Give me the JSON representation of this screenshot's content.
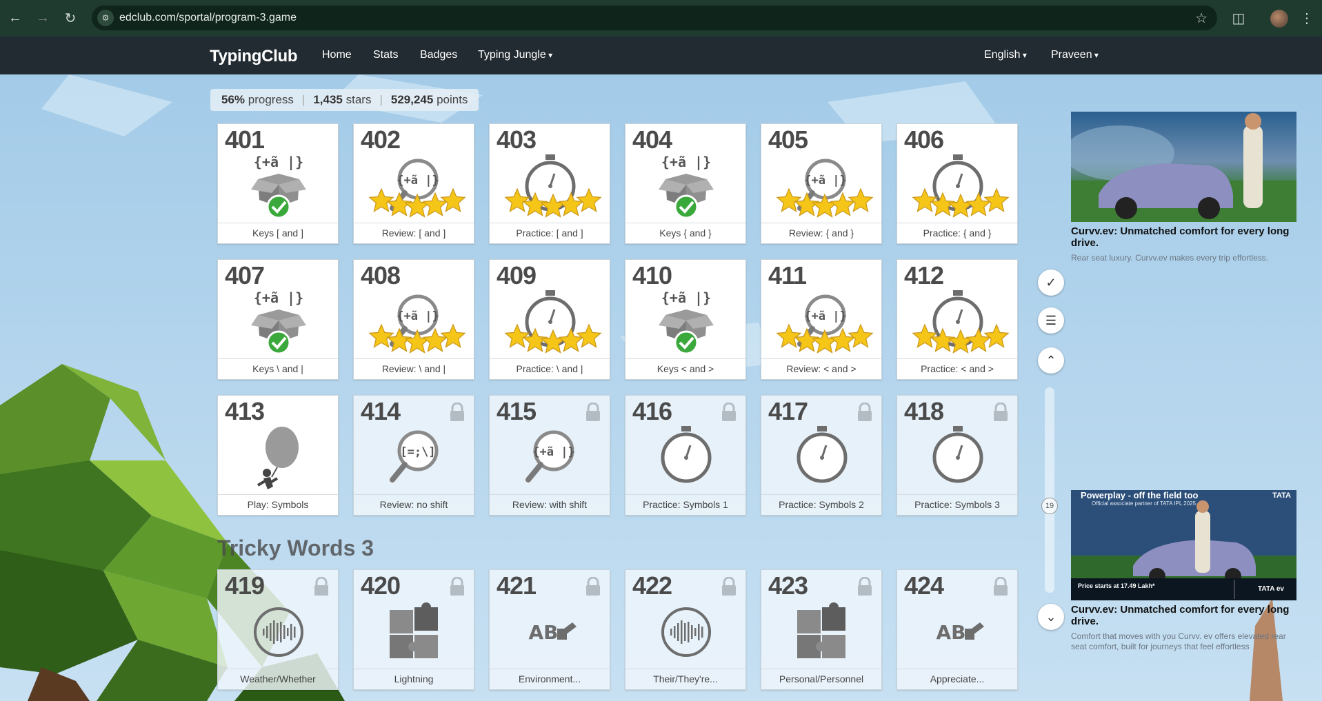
{
  "browser": {
    "url": "edclub.com/sportal/program-3.game"
  },
  "appnav": {
    "brand": "TypingClub",
    "links": [
      "Home",
      "Stats",
      "Badges",
      "Typing Jungle"
    ],
    "language": "English",
    "user": "Praveen"
  },
  "progress": {
    "percent": "56%",
    "percent_label": "progress",
    "stars": "1,435",
    "stars_label": "stars",
    "points": "529,245",
    "points_label": "points"
  },
  "lessons": [
    {
      "num": "401",
      "label": "Keys [ and ]",
      "type": "keys",
      "symbols": "{+ã |}",
      "status": "done",
      "locked": false
    },
    {
      "num": "402",
      "label": "Review: [ and ]",
      "type": "review",
      "symbols": "{+ã |}",
      "status": "stars",
      "locked": false
    },
    {
      "num": "403",
      "label": "Practice: [ and ]",
      "type": "practice",
      "symbols": "",
      "status": "stars",
      "locked": false
    },
    {
      "num": "404",
      "label": "Keys { and }",
      "type": "keys",
      "symbols": "{+ã |}",
      "status": "done",
      "locked": false
    },
    {
      "num": "405",
      "label": "Review: { and }",
      "type": "review",
      "symbols": "{+ã |}",
      "status": "stars",
      "locked": false
    },
    {
      "num": "406",
      "label": "Practice: { and }",
      "type": "practice",
      "symbols": "",
      "status": "stars",
      "locked": false
    },
    {
      "num": "407",
      "label": "Keys \\ and |",
      "type": "keys",
      "symbols": "{+ã |}",
      "status": "done",
      "locked": false
    },
    {
      "num": "408",
      "label": "Review: \\ and |",
      "type": "review",
      "symbols": "{+ã |}",
      "status": "stars",
      "locked": false
    },
    {
      "num": "409",
      "label": "Practice: \\ and |",
      "type": "practice",
      "symbols": "",
      "status": "stars",
      "locked": false
    },
    {
      "num": "410",
      "label": "Keys < and >",
      "type": "keys",
      "symbols": "{+ã |}",
      "status": "done",
      "locked": false
    },
    {
      "num": "411",
      "label": "Review: < and >",
      "type": "review",
      "symbols": "{+ã |}",
      "status": "stars",
      "locked": false
    },
    {
      "num": "412",
      "label": "Practice: < and >",
      "type": "practice",
      "symbols": "",
      "status": "stars",
      "locked": false
    },
    {
      "num": "413",
      "label": "Play: Symbols",
      "type": "play",
      "symbols": "",
      "status": "none",
      "locked": false
    },
    {
      "num": "414",
      "label": "Review: no shift",
      "type": "review",
      "symbols": "[=;\\]",
      "status": "none",
      "locked": true
    },
    {
      "num": "415",
      "label": "Review: with shift",
      "type": "review",
      "symbols": "{+ã |}",
      "status": "none",
      "locked": true
    },
    {
      "num": "416",
      "label": "Practice: Symbols 1",
      "type": "practice",
      "symbols": "",
      "status": "none",
      "locked": true
    },
    {
      "num": "417",
      "label": "Practice: Symbols 2",
      "type": "practice",
      "symbols": "",
      "status": "none",
      "locked": true
    },
    {
      "num": "418",
      "label": "Practice: Symbols 3",
      "type": "practice",
      "symbols": "",
      "status": "none",
      "locked": true
    }
  ],
  "section_title": "Tricky Words 3",
  "lessons2": [
    {
      "num": "419",
      "label": "Weather/Whether",
      "type": "audio",
      "locked": true
    },
    {
      "num": "420",
      "label": "Lightning",
      "type": "puzzle",
      "locked": true
    },
    {
      "num": "421",
      "label": "Environment...",
      "type": "abc",
      "locked": true
    },
    {
      "num": "422",
      "label": "Their/They're...",
      "type": "audio",
      "locked": true
    },
    {
      "num": "423",
      "label": "Personal/Personnel",
      "type": "puzzle",
      "locked": true
    },
    {
      "num": "424",
      "label": "Appreciate...",
      "type": "abc",
      "locked": true
    }
  ],
  "side": {
    "page_count": "19"
  },
  "ads": [
    {
      "title": "Curvv.ev: Unmatched comfort for every long drive.",
      "desc": "Rear seat luxury. Curvv.ev makes every trip effortless."
    },
    {
      "banner": "Powerplay - off the field too",
      "brand": "TATA",
      "sub": "Official associate partner of TATA IPL 2025",
      "price": "Price starts at 17.49 Lakh*",
      "brand2": "TATA ev",
      "title": "Curvv.ev: Unmatched comfort for every long drive.",
      "desc": "Comfort that moves with you Curvv. ev offers elevated rear seat comfort, built for journeys that feel effortless"
    }
  ]
}
